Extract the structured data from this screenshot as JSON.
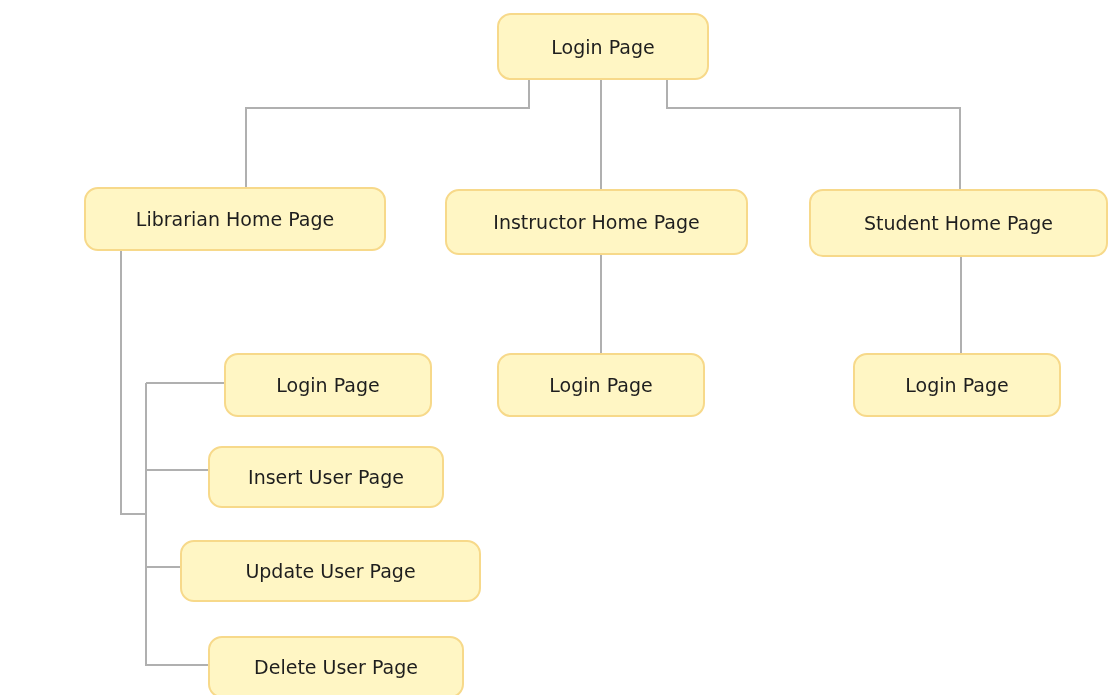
{
  "diagram": {
    "root": {
      "label": "Login Page",
      "children": [
        {
          "label": "Librarian Home Page",
          "children": [
            {
              "label": "Login Page"
            },
            {
              "label": "Insert User Page"
            },
            {
              "label": "Update User Page"
            },
            {
              "label": "Delete User Page"
            }
          ]
        },
        {
          "label": "Instructor Home Page",
          "children": [
            {
              "label": "Login Page"
            }
          ]
        },
        {
          "label": "Student Home Page",
          "children": [
            {
              "label": "Login Page"
            }
          ]
        }
      ]
    }
  }
}
